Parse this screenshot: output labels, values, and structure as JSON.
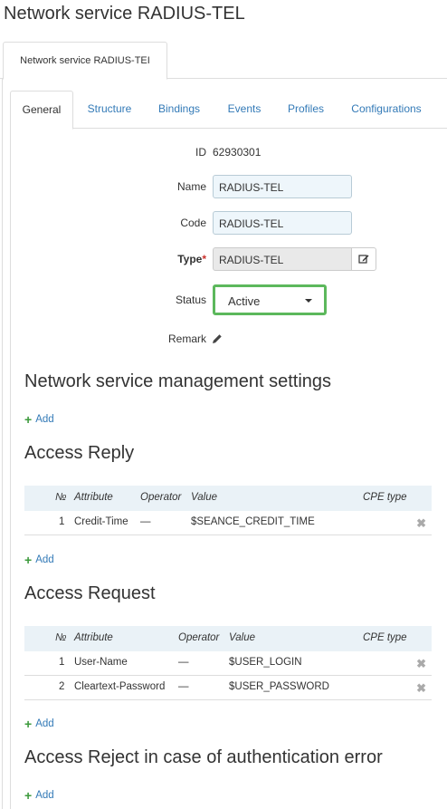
{
  "page_title": "Network service RADIUS-TEL",
  "outer_tab": "Network service RADIUS-TEI",
  "tabs": [
    "General",
    "Structure",
    "Bindings",
    "Events",
    "Profiles",
    "Configurations"
  ],
  "form": {
    "id_label": "ID",
    "id_value": "62930301",
    "name_label": "Name",
    "name_value": "RADIUS-TEL",
    "code_label": "Code",
    "code_value": "RADIUS-TEL",
    "type_label": "Type",
    "type_required": "*",
    "type_value": "RADIUS-TEL",
    "status_label": "Status",
    "status_value": "Active",
    "remark_label": "Remark"
  },
  "sections": {
    "mgmt_title": "Network service management settings",
    "reply_title": "Access Reply",
    "request_title": "Access Request",
    "reject_title": "Access Reject in case of authentication error",
    "add_label": "Add"
  },
  "reply_table": {
    "headers": [
      "№",
      "Attribute",
      "Operator",
      "Value",
      "CPE type"
    ],
    "rows": [
      {
        "no": "1",
        "attribute": "Credit-Time",
        "operator": "—",
        "value": "$SEANCE_CREDIT_TIME"
      }
    ]
  },
  "request_table": {
    "headers": [
      "№",
      "Attribute",
      "Operator",
      "Value",
      "CPE type"
    ],
    "rows": [
      {
        "no": "1",
        "attribute": "User-Name",
        "operator": "—",
        "value": "$USER_LOGIN"
      },
      {
        "no": "2",
        "attribute": "Cleartext-Password",
        "operator": "—",
        "value": "$USER_PASSWORD"
      }
    ]
  },
  "colors": {
    "link": "#337ab7",
    "focus_green": "#5cb85c",
    "add_plus": "#3c9a3c"
  }
}
